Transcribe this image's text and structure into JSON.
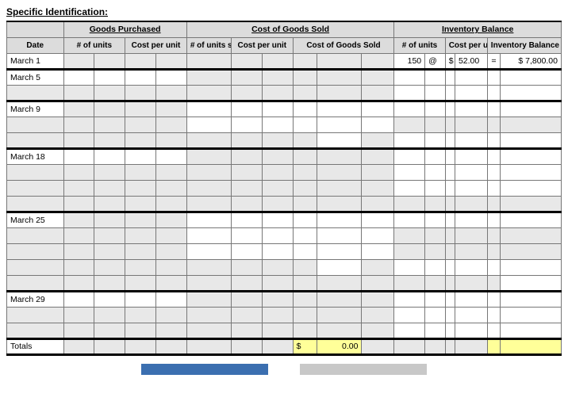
{
  "title": "Specific Identification:",
  "sections": {
    "goods_purchased": "Goods Purchased",
    "cogs": "Cost of Goods Sold",
    "inventory_balance": "Inventory Balance"
  },
  "columns": {
    "date": "Date",
    "gp_units": "# of units",
    "gp_cost": "Cost per unit",
    "cogs_units": "# of units sold",
    "cogs_cost": "Cost per unit",
    "cogs_total": "Cost of Goods Sold",
    "ib_units": "# of units",
    "ib_cost": "Cost per unit",
    "ib_total": "Inventory Balance"
  },
  "rows": {
    "march1": {
      "date": "March 1",
      "ib_units": "150",
      "ib_at": "@",
      "ib_cost_prefix": "$",
      "ib_cost": "52.00",
      "ib_eq": "=",
      "ib_total": "$   7,800.00"
    },
    "march5": {
      "date": "March 5"
    },
    "march9": {
      "date": "March 9"
    },
    "march18": {
      "date": "March 18"
    },
    "march25": {
      "date": "March 25"
    },
    "march29": {
      "date": "March 29"
    },
    "totals": {
      "label": "Totals",
      "cogs_total_prefix": "$",
      "cogs_total": "0.00"
    }
  }
}
